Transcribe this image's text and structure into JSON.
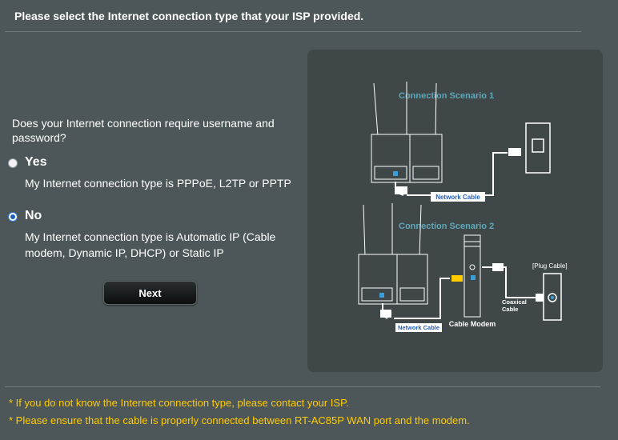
{
  "header": {
    "title": "Please select the Internet connection type that your ISP provided."
  },
  "question": "Does your Internet connection require username and password?",
  "options": [
    {
      "title": "Yes",
      "description": "My Internet connection type is PPPoE, L2TP or PPTP",
      "selected": false
    },
    {
      "title": "No",
      "description": "My Internet connection type is Automatic IP (Cable modem, Dynamic IP, DHCP) or Static IP",
      "selected": true
    }
  ],
  "next_label": "Next",
  "diagram": {
    "scenario1_title": "Connection Scenario 1",
    "scenario2_title": "Connection Scenario 2",
    "network_cable_label": "Network Cable",
    "cable_modem_label": "Cable Modem",
    "plug_cable_label": "[Plug Cable]",
    "coaxial_label_1": "Coaxical",
    "coaxial_label_2": "Cable"
  },
  "notes": [
    "* If you do not know the Internet connection type, please contact your ISP.",
    "* Please ensure that the cable is properly connected between RT-AC85P WAN port and the modem."
  ],
  "colors": {
    "background": "#4d5659",
    "panel": "#3f4749",
    "note": "#ffcc00",
    "scenario_title": "#5fa8b8"
  }
}
